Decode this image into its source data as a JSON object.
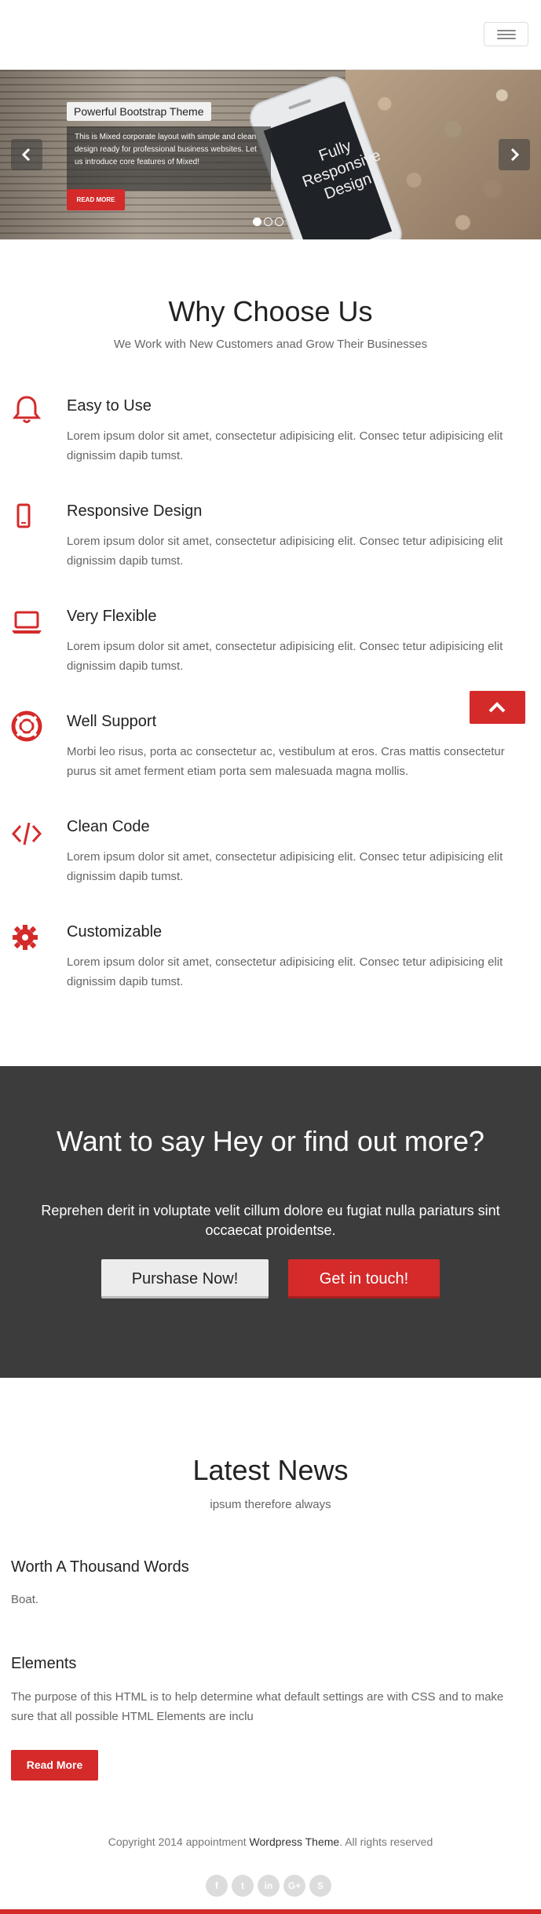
{
  "colors": {
    "accent": "#d42a2a",
    "cta_bg": "#3c3c3c",
    "text": "#666666",
    "heading": "#222222"
  },
  "header": {
    "menu_icon": "hamburger-icon"
  },
  "slider": {
    "caption_title": "Powerful Bootstrap Theme",
    "caption_text": "This is Mixed corporate layout with simple and clean design ready for professional business websites. Let us introduce core features of Mixed!",
    "caption_button": "READ MORE",
    "phone_text": "Fully Responsive Design",
    "slide_count": 3,
    "active_slide": 1
  },
  "why": {
    "title": "Why Choose Us",
    "subtitle": "We Work with New Customers anad Grow Their Businesses",
    "features": [
      {
        "icon": "bell-icon",
        "title": "Easy to Use",
        "text": "Lorem ipsum dolor sit amet, consectetur adipisicing elit. Consec tetur adipisicing elit dignissim dapib tumst."
      },
      {
        "icon": "mobile-icon",
        "title": "Responsive Design",
        "text": "Lorem ipsum dolor sit amet, consectetur adipisicing elit. Consec tetur adipisicing elit dignissim dapib tumst."
      },
      {
        "icon": "laptop-icon",
        "title": "Very Flexible",
        "text": "Lorem ipsum dolor sit amet, consectetur adipisicing elit. Consec tetur adipisicing elit dignissim dapib tumst."
      },
      {
        "icon": "life-ring-icon",
        "title": "Well Support",
        "text": "Morbi leo risus, porta ac consectetur ac, vestibulum at eros. Cras mattis consectetur purus sit amet ferment etiam porta sem malesuada magna mollis."
      },
      {
        "icon": "code-icon",
        "title": "Clean Code",
        "text": "Lorem ipsum dolor sit amet, consectetur adipisicing elit. Consec tetur adipisicing elit dignissim dapib tumst."
      },
      {
        "icon": "gear-icon",
        "title": "Customizable",
        "text": "Lorem ipsum dolor sit amet, consectetur adipisicing elit. Consec tetur adipisicing elit dignissim dapib tumst."
      }
    ]
  },
  "cta": {
    "title": "Want to say Hey or find out more?",
    "text": "Reprehen derit in voluptate velit cillum dolore eu fugiat nulla pariaturs sint occaecat proidentse.",
    "primary_button": "Purshase Now!",
    "secondary_button": "Get in touch!"
  },
  "news": {
    "title": "Latest News",
    "subtitle": "ipsum therefore always",
    "items": [
      {
        "title": "Worth A Thousand Words",
        "text": "Boat."
      },
      {
        "title": "Elements",
        "text": "The purpose of this HTML is to help determine what default settings are with CSS and to make sure that all possible HTML Elements are inclu"
      }
    ],
    "read_more": "Read More"
  },
  "footer": {
    "copyright_prefix": "Copyright 2014 appointment ",
    "brand": "Wordpress Theme",
    "copyright_suffix": ". All rights reserved",
    "socials": [
      {
        "icon": "facebook-icon",
        "glyph": "f"
      },
      {
        "icon": "twitter-icon",
        "glyph": "t"
      },
      {
        "icon": "linkedin-icon",
        "glyph": "in"
      },
      {
        "icon": "google-plus-icon",
        "glyph": "G+"
      },
      {
        "icon": "skype-icon",
        "glyph": "S"
      }
    ]
  }
}
